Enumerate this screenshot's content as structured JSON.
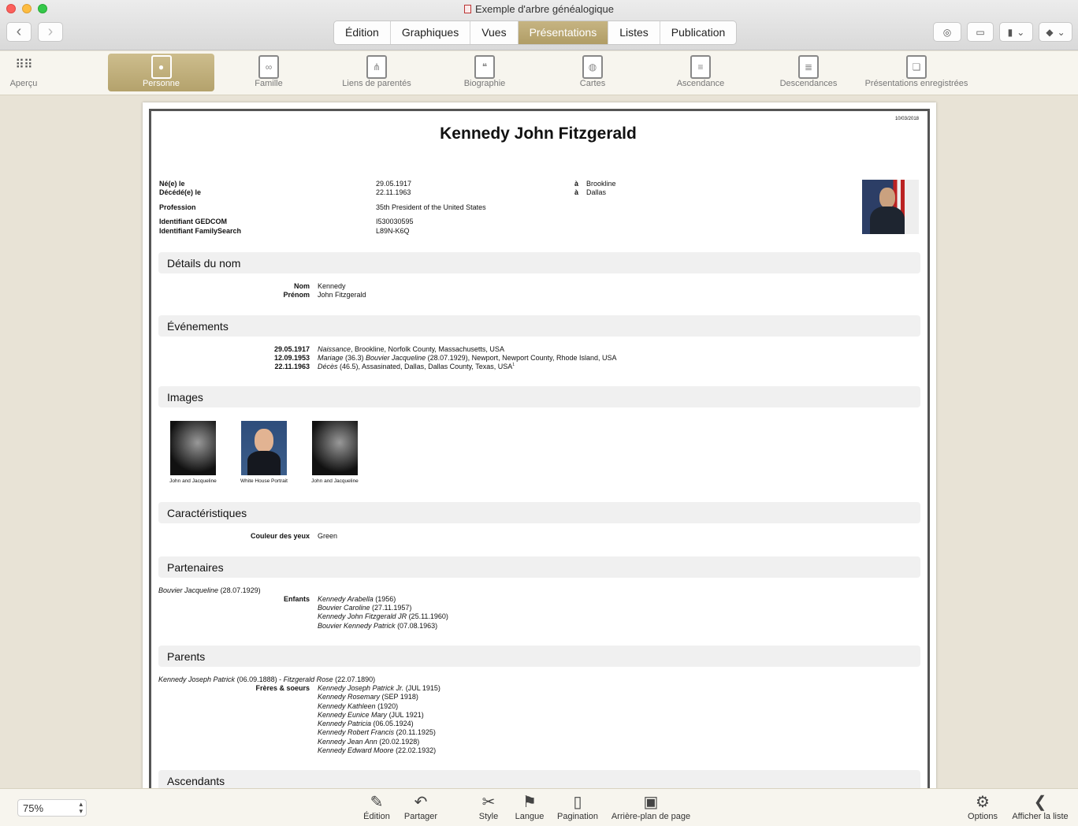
{
  "window": {
    "title": "Exemple d'arbre généalogique"
  },
  "main_tabs": [
    "Édition",
    "Graphiques",
    "Vues",
    "Présentations",
    "Listes",
    "Publication"
  ],
  "toolbar": {
    "apercu": "Aperçu",
    "items": [
      "Personne",
      "Famille",
      "Liens de parentés",
      "Biographie",
      "Cartes",
      "Ascendance",
      "Descendances",
      "Présentations enregistrées"
    ]
  },
  "person": {
    "date": "10/03/2018",
    "title": "Kennedy John Fitzgerald",
    "facts": {
      "born_label": "Né(e) le",
      "born_date": "29.05.1917",
      "born_at": "à",
      "born_place": "Brookline",
      "died_label": "Décédé(e) le",
      "died_date": "22.11.1963",
      "died_at": "à",
      "died_place": "Dallas",
      "profession_label": "Profession",
      "profession": "35th President of the United States",
      "gedcom_label": "Identifiant GEDCOM",
      "gedcom": "I530030595",
      "fs_label": "Identifiant FamilySearch",
      "fs": "L89N-K6Q"
    },
    "name_section": {
      "title": "Détails du nom",
      "nom_label": "Nom",
      "nom": "Kennedy",
      "prenom_label": "Prénom",
      "prenom": "John Fitzgerald"
    },
    "events": {
      "title": "Événements",
      "rows": [
        {
          "date": "29.05.1917",
          "type": "Naissance",
          "rest": ", Brookline, Norfolk County, Massachusetts, USA"
        },
        {
          "date": "12.09.1953",
          "type": "Mariage",
          "mid": " (36.3) ",
          "partner": "Bouvier Jacqueline",
          "rest": " (28.07.1929), Newport, Newport County, Rhode Island, USA"
        },
        {
          "date": "22.11.1963",
          "type": "Décès",
          "rest": " (46.5), Assasinated, Dallas, Dallas County, Texas, USA",
          "sup": "1"
        }
      ]
    },
    "images": {
      "title": "Images",
      "captions": [
        "John and Jacqueline",
        "White House Portrait",
        "John and Jacqueline"
      ]
    },
    "characteristics": {
      "title": "Caractéristiques",
      "eye_label": "Couleur des yeux",
      "eye": "Green"
    },
    "partners": {
      "title": "Partenaires",
      "partner": "Bouvier Jacqueline",
      "partner_date": " (28.07.1929)",
      "children_label": "Enfants",
      "children": [
        {
          "name": "Kennedy Arabella",
          "date": " (1956)"
        },
        {
          "name": "Bouvier Caroline",
          "date": " (27.11.1957)"
        },
        {
          "name": "Kennedy John Fitzgerald JR",
          "date": " (25.11.1960)"
        },
        {
          "name": "Bouvier Kennedy Patrick",
          "date": " (07.08.1963)"
        }
      ]
    },
    "parents": {
      "title": "Parents",
      "father": "Kennedy Joseph Patrick",
      "father_date": " (06.09.1888) - ",
      "mother": "Fitzgerald Rose",
      "mother_date": " (22.07.1890)",
      "siblings_label": "Frères & soeurs",
      "siblings": [
        {
          "name": "Kennedy Joseph Patrick Jr.",
          "date": " (JUL 1915)"
        },
        {
          "name": "Kennedy Rosemary",
          "date": " (SEP 1918)"
        },
        {
          "name": "Kennedy Kathleen",
          "date": " (1920)"
        },
        {
          "name": "Kennedy Eunice Mary",
          "date": " (JUL 1921)"
        },
        {
          "name": "Kennedy Patricia",
          "date": " (06.05.1924)"
        },
        {
          "name": "Kennedy Robert Francis",
          "date": " (20.11.1925)"
        },
        {
          "name": "Kennedy Jean Ann",
          "date": " (20.02.1928)"
        },
        {
          "name": "Kennedy Edward Moore",
          "date": " (22.02.1932)"
        }
      ]
    },
    "ascendants": {
      "title": "Ascendants"
    }
  },
  "bottom": {
    "zoom": "75%",
    "tools": [
      "Édition",
      "Partager",
      "Style",
      "Langue",
      "Pagination",
      "Arrière-plan de page"
    ],
    "options": "Options",
    "show_list": "Afficher la liste"
  }
}
